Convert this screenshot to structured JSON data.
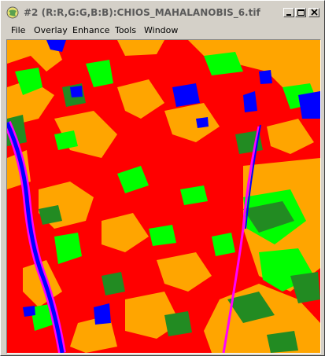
{
  "window": {
    "title": "#2 (R:R,G:G,B:B):CHIOS_MAHALANOBIS_6.tif"
  },
  "menu": [
    "File",
    "Overlay",
    "Enhance",
    "Tools",
    "Window"
  ],
  "image": {
    "description": "classification-map",
    "colors": {
      "background": "#ff0000",
      "class_orange": "#ffa500",
      "class_green": "#00ff00",
      "class_darkgreen": "#228b22",
      "class_blue": "#0000ff",
      "class_magenta": "#ff00ff"
    }
  },
  "icons": {
    "app": "app-globe-icon",
    "minimize": "minimize-icon",
    "maximize": "maximize-icon",
    "close": "close-icon"
  }
}
